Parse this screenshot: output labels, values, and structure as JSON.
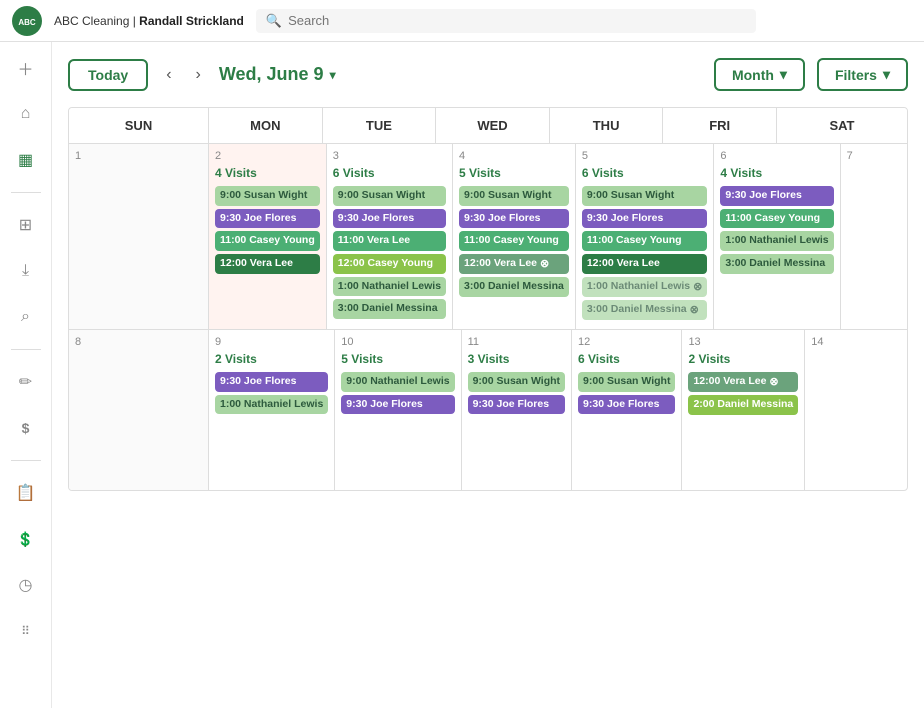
{
  "nav": {
    "logo_text": "ABC",
    "breadcrumb_company": "ABC Cleaning",
    "breadcrumb_user": "Randall Strickland",
    "search_placeholder": "Search"
  },
  "sidebar": {
    "icons": [
      {
        "name": "plus-icon",
        "symbol": "+"
      },
      {
        "name": "home-icon",
        "symbol": "⌂"
      },
      {
        "name": "calendar-icon",
        "symbol": "▦"
      },
      {
        "name": "divider1",
        "type": "divider"
      },
      {
        "name": "grid-icon",
        "symbol": "⊞"
      },
      {
        "name": "download-icon",
        "symbol": "⤓"
      },
      {
        "name": "search-icon",
        "symbol": "⌕"
      },
      {
        "name": "divider2",
        "type": "divider"
      },
      {
        "name": "tag-icon",
        "symbol": "✎"
      },
      {
        "name": "dollar-icon",
        "symbol": "$"
      },
      {
        "name": "divider3",
        "type": "divider"
      },
      {
        "name": "report-icon",
        "symbol": "📋"
      },
      {
        "name": "dollar2-icon",
        "symbol": "💲"
      },
      {
        "name": "clock-icon",
        "symbol": "◷"
      },
      {
        "name": "apps-icon",
        "symbol": "⁞⁞"
      }
    ]
  },
  "controls": {
    "today_label": "Today",
    "date_label": "Wed, June 9",
    "month_label": "Month",
    "filters_label": "Filters"
  },
  "calendar": {
    "header": [
      "SUN",
      "MON",
      "TUE",
      "WED",
      "THU",
      "FRI",
      "SAT"
    ],
    "weeks": [
      {
        "days": [
          {
            "num": "1",
            "col": "sun",
            "visits": null,
            "events": []
          },
          {
            "num": "2",
            "col": "mon",
            "highlighted": true,
            "visits": "4 Visits",
            "events": [
              {
                "time": "9:00 Susan Wight",
                "color": "light-green"
              },
              {
                "time": "9:30 Joe Flores",
                "color": "purple"
              },
              {
                "time": "11:00 Casey Young",
                "color": "green"
              },
              {
                "time": "12:00 Vera Lee",
                "color": "dark-green"
              }
            ]
          },
          {
            "num": "3",
            "col": "tue",
            "visits": "6 Visits",
            "events": [
              {
                "time": "9:00 Susan Wight",
                "color": "light-green"
              },
              {
                "time": "9:30 Joe Flores",
                "color": "purple"
              },
              {
                "time": "11:00 Vera Lee",
                "color": "green"
              },
              {
                "time": "12:00 Casey Young",
                "color": "olive"
              },
              {
                "time": "1:00 Nathaniel Lewis",
                "color": "light-green"
              },
              {
                "time": "3:00 Daniel Messina",
                "color": "light-green"
              }
            ]
          },
          {
            "num": "4",
            "col": "wed",
            "visits": "5 Visits",
            "events": [
              {
                "time": "9:00 Susan Wight",
                "color": "light-green"
              },
              {
                "time": "9:30 Joe Flores",
                "color": "purple"
              },
              {
                "time": "11:00 Casey Young",
                "color": "green"
              },
              {
                "time": "12:00 Vera Lee",
                "color": "dark-green",
                "canceled": true
              },
              {
                "time": "3:00 Daniel Messina",
                "color": "light-green"
              }
            ]
          },
          {
            "num": "5",
            "col": "thu",
            "visits": "6 Visits",
            "events": [
              {
                "time": "9:00 Susan Wight",
                "color": "light-green"
              },
              {
                "time": "9:30 Joe Flores",
                "color": "purple"
              },
              {
                "time": "11:00 Casey Young",
                "color": "green"
              },
              {
                "time": "12:00 Vera Lee",
                "color": "dark-green"
              },
              {
                "time": "1:00 Nathaniel Lewis",
                "color": "light-green",
                "canceled": true
              },
              {
                "time": "3:00 Daniel Messina",
                "color": "light-green",
                "canceled": true
              }
            ]
          },
          {
            "num": "6",
            "col": "fri",
            "visits": "4 Visits",
            "events": [
              {
                "time": "9:30 Joe Flores",
                "color": "purple"
              },
              {
                "time": "11:00 Casey Young",
                "color": "green"
              },
              {
                "time": "1:00 Nathaniel Lewis",
                "color": "light-green"
              },
              {
                "time": "3:00 Daniel Messina",
                "color": "light-green"
              }
            ]
          },
          {
            "num": "7",
            "col": "sat",
            "visits": null,
            "events": []
          }
        ]
      },
      {
        "days": [
          {
            "num": "8",
            "col": "sun",
            "visits": null,
            "events": []
          },
          {
            "num": "9",
            "col": "mon",
            "visits": "2 Visits",
            "events": [
              {
                "time": "9:30 Joe Flores",
                "color": "purple"
              },
              {
                "time": "1:00 Nathaniel Lewis",
                "color": "light-green"
              }
            ]
          },
          {
            "num": "10",
            "col": "tue",
            "visits": "5 Visits",
            "events": [
              {
                "time": "9:00 Nathaniel Lewis",
                "color": "light-green"
              },
              {
                "time": "9:30 Joe Flores",
                "color": "purple"
              }
            ]
          },
          {
            "num": "11",
            "col": "wed",
            "visits": "3 Visits",
            "events": [
              {
                "time": "9:00 Susan Wight",
                "color": "light-green"
              },
              {
                "time": "9:30 Joe Flores",
                "color": "purple"
              }
            ]
          },
          {
            "num": "12",
            "col": "thu",
            "visits": "6 Visits",
            "events": [
              {
                "time": "9:00 Susan Wight",
                "color": "light-green"
              },
              {
                "time": "9:30 Joe Flores",
                "color": "purple"
              }
            ]
          },
          {
            "num": "13",
            "col": "fri",
            "visits": "2 Visits",
            "events": [
              {
                "time": "12:00 Vera Lee",
                "color": "dark-green",
                "canceled": true
              },
              {
                "time": "2:00 Daniel Messina",
                "color": "olive"
              }
            ]
          },
          {
            "num": "14",
            "col": "sat",
            "visits": null,
            "events": []
          }
        ]
      }
    ]
  }
}
